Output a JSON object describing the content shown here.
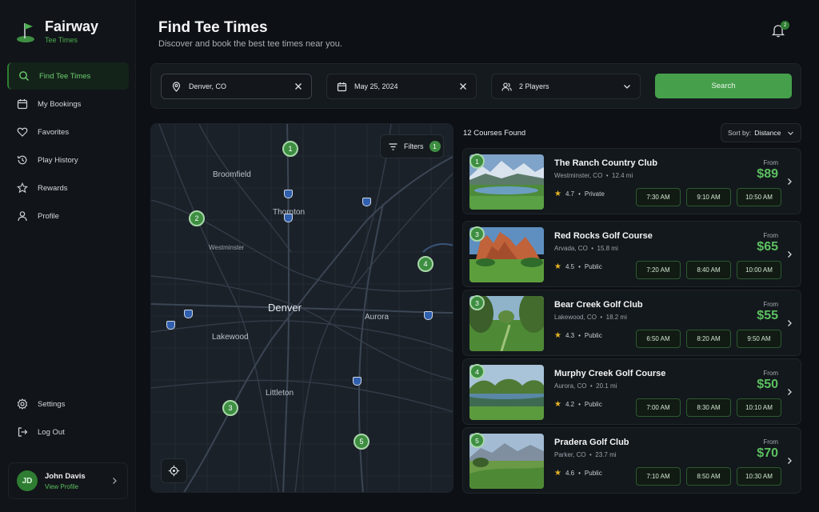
{
  "brand": {
    "name": "Fairway",
    "tagline": "Tee Times"
  },
  "nav": {
    "items": [
      {
        "label": "Find Tee Times",
        "icon": "search-icon",
        "active": true
      },
      {
        "label": "My Bookings",
        "icon": "calendar-icon"
      },
      {
        "label": "Favorites",
        "icon": "heart-icon"
      },
      {
        "label": "Play History",
        "icon": "history-icon"
      },
      {
        "label": "Rewards",
        "icon": "star-icon"
      },
      {
        "label": "Profile",
        "icon": "user-icon"
      }
    ],
    "bottom": [
      {
        "label": "Settings",
        "icon": "gear-icon"
      },
      {
        "label": "Log Out",
        "icon": "logout-icon"
      }
    ]
  },
  "user": {
    "initials": "JD",
    "name": "John Davis",
    "link": "View Profile"
  },
  "header": {
    "title": "Find Tee Times",
    "subtitle": "Discover and book the best tee times near you.",
    "notifications": "2"
  },
  "search": {
    "location": "Denver, CO",
    "date": "May 25, 2024",
    "players": "2 Players",
    "button": "Search"
  },
  "map": {
    "filters_label": "Filters",
    "filters_count": "1",
    "cities": {
      "broomfield": "Broomfield",
      "thornton": "Thornton",
      "westminster": "Westminster",
      "denver": "Denver",
      "aurora": "Aurora",
      "lakewood": "Lakewood",
      "littleton": "Littleton"
    },
    "pins": [
      "1",
      "2",
      "4",
      "3",
      "5"
    ]
  },
  "results": {
    "count_label": "12 Courses Found",
    "sort_prefix": "Sort by:",
    "sort_value": "Distance",
    "from_label": "From",
    "courses": [
      {
        "pin": "1",
        "name": "The Ranch Country Club",
        "location": "Westminster, CO",
        "distance": "12.4 mi",
        "rating": "4.7",
        "type": "Private",
        "price": "$89",
        "times": [
          "7:30 AM",
          "9:10 AM",
          "10:50 AM"
        ]
      },
      {
        "pin": "3",
        "name": "Red Rocks Golf Course",
        "location": "Arvada, CO",
        "distance": "15.8 mi",
        "rating": "4.5",
        "type": "Public",
        "price": "$65",
        "times": [
          "7:20 AM",
          "8:40 AM",
          "10:00 AM"
        ]
      },
      {
        "pin": "3",
        "name": "Bear Creek Golf Club",
        "location": "Lakewood, CO",
        "distance": "18.2 mi",
        "rating": "4.3",
        "type": "Public",
        "price": "$55",
        "times": [
          "6:50 AM",
          "8:20 AM",
          "9:50 AM"
        ]
      },
      {
        "pin": "4",
        "name": "Murphy Creek Golf Course",
        "location": "Aurora, CO",
        "distance": "20.1 mi",
        "rating": "4.2",
        "type": "Public",
        "price": "$50",
        "times": [
          "7:00 AM",
          "8:30 AM",
          "10:10 AM"
        ]
      },
      {
        "pin": "5",
        "name": "Pradera Golf Club",
        "location": "Parker, CO",
        "distance": "23.7 mi",
        "rating": "4.6",
        "type": "Public",
        "price": "$70",
        "times": [
          "7:10 AM",
          "8:50 AM",
          "10:30 AM"
        ]
      }
    ]
  },
  "colors": {
    "accent": "#46a04b",
    "price": "#5cc060",
    "background": "#0d1014"
  }
}
